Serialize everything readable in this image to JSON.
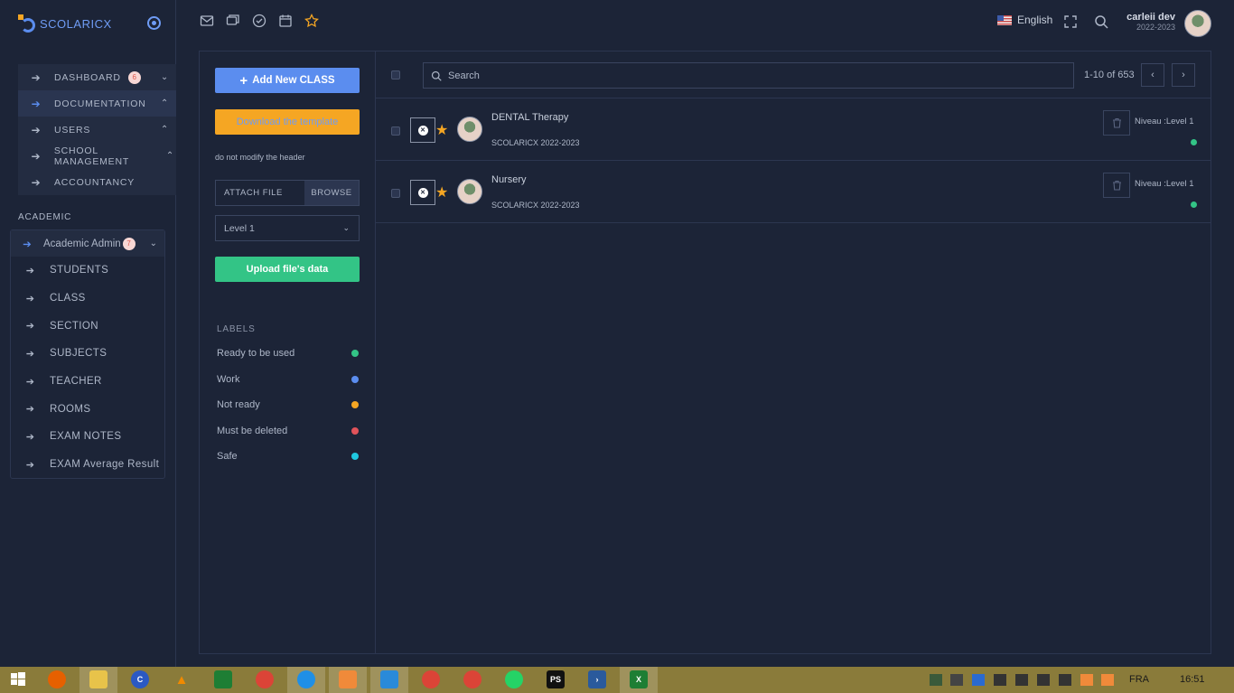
{
  "app": {
    "name": "SCOLARICX"
  },
  "sidebar": {
    "top_items": [
      {
        "label": "DASHBOARD",
        "badge": "6"
      },
      {
        "label": "DOCUMENTATION"
      },
      {
        "label": "USERS"
      },
      {
        "label": "SCHOOL MANAGEMENT"
      },
      {
        "label": "ACCOUNTANCY"
      }
    ],
    "section_title": "ACADEMIC",
    "academic": {
      "head_label": "Academic Admin",
      "head_badge": "7",
      "items": [
        "STUDENTS",
        "CLASS",
        "SECTION",
        "SUBJECTS",
        "TEACHER",
        "ROOMS",
        "EXAM NOTES",
        "EXAM Average Result"
      ]
    }
  },
  "topbar": {
    "icons": [
      "mail-icon",
      "chat-icon",
      "check-circle-icon",
      "calendar-icon",
      "star-icon"
    ],
    "language": "English",
    "user_name": "carleii dev",
    "user_year": "2022-2023"
  },
  "actions": {
    "add_label": "Add New CLASS",
    "download_label": "Download the template",
    "hint": "do not modify the header",
    "attach_label": "ATTACH FILE",
    "browse_label": "BROWSE",
    "level_selected": "Level 1",
    "upload_label": "Upload file's data"
  },
  "labels": {
    "title": "LABELS",
    "items": [
      {
        "label": "Ready to be used",
        "color": "#33c486"
      },
      {
        "label": "Work",
        "color": "#5b8def"
      },
      {
        "label": "Not ready",
        "color": "#f5a623"
      },
      {
        "label": "Must be deleted",
        "color": "#e0535a"
      },
      {
        "label": "Safe",
        "color": "#1fc8e0"
      }
    ]
  },
  "list": {
    "search_placeholder": "Search",
    "pagination": "1-10 of 653",
    "rows": [
      {
        "title": "DENTAL Therapy",
        "subtitle": "SCOLARICX 2022-2023",
        "level": "Niveau :Level 1"
      },
      {
        "title": "Nursery",
        "subtitle": "SCOLARICX 2022-2023",
        "level": "Niveau :Level 1"
      }
    ]
  },
  "taskbar": {
    "language": "FRA",
    "time": "16:51"
  }
}
